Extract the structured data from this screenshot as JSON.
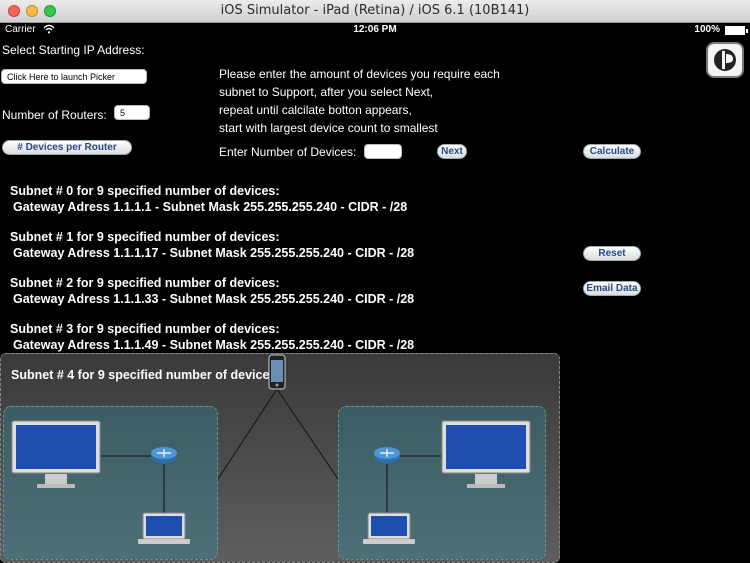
{
  "window": {
    "title": "iOS Simulator - iPad (Retina) / iOS 6.1 (10B141)"
  },
  "status_bar": {
    "carrier": "Carrier",
    "wifi": "wifi-icon",
    "time": "12:06 PM",
    "battery": "100%"
  },
  "form": {
    "start_ip_label": "Select Starting IP Address:",
    "picker_field": "Click Here to launch Picker",
    "routers_label": "Number of Routers:",
    "routers_value": "5",
    "devices_per_router_button": "# Devices per Router",
    "instructions": [
      "Please enter the amount of devices you require each",
      "subnet to Support, after you select Next,",
      "repeat until calcilate botton appears,",
      "start with largest device count to smallest"
    ],
    "devices_label": "Enter Number of Devices:",
    "devices_value": "",
    "next_button": "Next",
    "calculate_button": "Calculate",
    "reset_button": "Reset",
    "email_button": "Email Data"
  },
  "subnets": [
    {
      "title": "Subnet # 0 for 9 specified number of devices:",
      "detail": "Gateway Adress 1.1.1.1 - Subnet Mask 255.255.255.240 - CIDR - /28"
    },
    {
      "title": "Subnet # 1 for 9 specified number of devices:",
      "detail": "Gateway Adress 1.1.1.17 - Subnet Mask 255.255.255.240 - CIDR - /28"
    },
    {
      "title": "Subnet # 2 for 9 specified number of devices:",
      "detail": "Gateway Adress 1.1.1.33 - Subnet Mask 255.255.255.240 - CIDR - /28"
    },
    {
      "title": "Subnet # 3 for 9 specified number of devices:",
      "detail": "Gateway Adress 1.1.1.49 - Subnet Mask 255.255.255.240 - CIDR - /28"
    },
    {
      "title": "Subnet # 4 for 9 specified number of devices:",
      "detail": ""
    }
  ],
  "icons": {
    "logo": "app-logo-icon",
    "diagram": "network-diagram"
  }
}
